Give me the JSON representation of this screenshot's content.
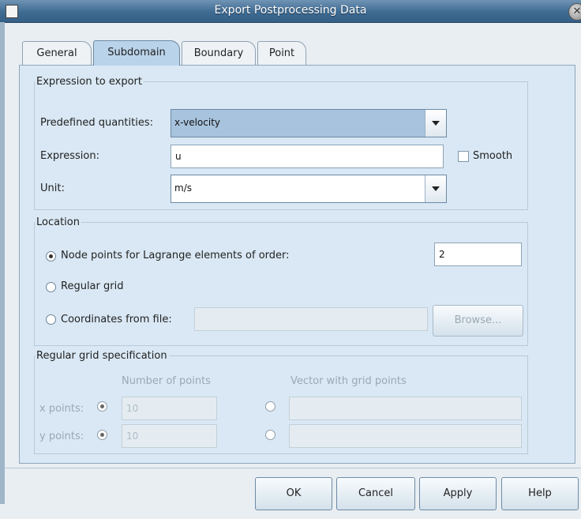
{
  "window": {
    "title": "Export Postprocessing Data"
  },
  "tabs": [
    {
      "label": "General"
    },
    {
      "label": "Subdomain"
    },
    {
      "label": "Boundary"
    },
    {
      "label": "Point"
    }
  ],
  "expression_group": {
    "legend": "Expression to export",
    "predefined_label": "Predefined quantities:",
    "predefined_value": "x-velocity",
    "expression_label": "Expression:",
    "expression_value": "u",
    "smooth_label": "Smooth",
    "unit_label": "Unit:",
    "unit_value": "m/s"
  },
  "location_group": {
    "legend": "Location",
    "node_points_label": "Node points for Lagrange elements of order:",
    "order_value": "2",
    "regular_grid_label": "Regular grid",
    "coords_label": "Coordinates from file:",
    "coords_value": "",
    "browse_label": "Browse..."
  },
  "grid_group": {
    "legend": "Regular grid specification",
    "col_number": "Number of points",
    "col_vector": "Vector with grid points",
    "x_label": "x points:",
    "x_value": "10",
    "y_label": "y points:",
    "y_value": "10"
  },
  "buttons": {
    "ok": "OK",
    "cancel": "Cancel",
    "apply": "Apply",
    "help": "Help"
  }
}
